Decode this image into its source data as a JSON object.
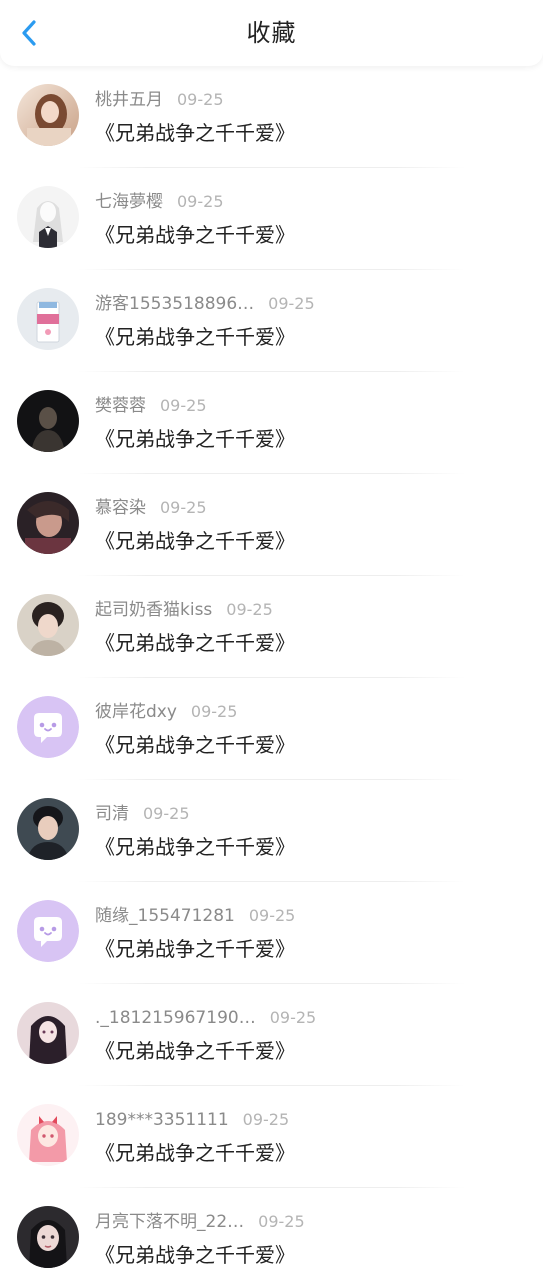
{
  "header": {
    "title": "收藏",
    "back_icon": "chevron-left-icon",
    "accent_color": "#2b9bf0"
  },
  "items": [
    {
      "user": "桃井五月",
      "date": "09-25",
      "book": "《兄弟战争之千千爱》",
      "avatar": "photo-avatar"
    },
    {
      "user": "七海夢樱",
      "date": "09-25",
      "book": "《兄弟战争之千千爱》",
      "avatar": "anime-girl-avatar"
    },
    {
      "user": "游客1553518896…",
      "date": "09-25",
      "book": "《兄弟战争之千千爱》",
      "avatar": "milk-carton-avatar"
    },
    {
      "user": "樊蓉蓉",
      "date": "09-25",
      "book": "《兄弟战争之千千爱》",
      "avatar": "photo-avatar"
    },
    {
      "user": "慕容染",
      "date": "09-25",
      "book": "《兄弟战争之千千爱》",
      "avatar": "photo-avatar"
    },
    {
      "user": "起司奶香猫kiss",
      "date": "09-25",
      "book": "《兄弟战争之千千爱》",
      "avatar": "photo-avatar"
    },
    {
      "user": "彼岸花dxy",
      "date": "09-25",
      "book": "《兄弟战争之千千爱》",
      "avatar": "default-chat-bubble-avatar"
    },
    {
      "user": "司清",
      "date": "09-25",
      "book": "《兄弟战争之千千爱》",
      "avatar": "photo-avatar"
    },
    {
      "user": "随缘_155471281",
      "date": "09-25",
      "book": "《兄弟战争之千千爱》",
      "avatar": "default-chat-bubble-avatar"
    },
    {
      "user": "._181215967190…",
      "date": "09-25",
      "book": "《兄弟战争之千千爱》",
      "avatar": "anime-girl-avatar"
    },
    {
      "user": "189***3351111",
      "date": "09-25",
      "book": "《兄弟战争之千千爱》",
      "avatar": "pink-anime-avatar"
    },
    {
      "user": "月亮下落不明_22…",
      "date": "09-25",
      "book": "《兄弟战争之千千爱》",
      "avatar": "photo-avatar"
    }
  ]
}
